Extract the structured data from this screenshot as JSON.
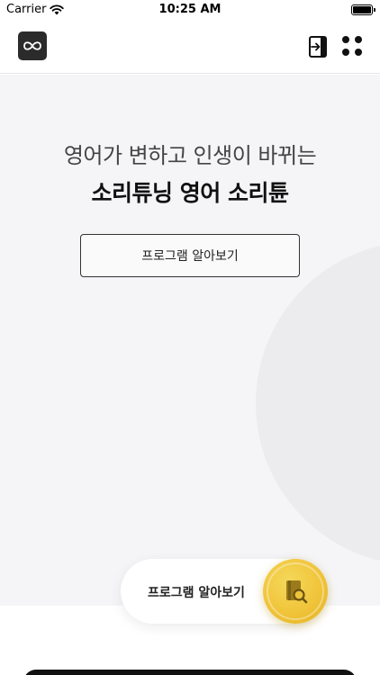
{
  "status_bar": {
    "carrier": "Carrier",
    "time": "10:25 AM",
    "wifi_icon": "wifi-icon",
    "battery_icon": "battery-icon"
  },
  "header": {
    "logo_icon": "infinity-logo-icon",
    "login_icon": "login-icon",
    "menu_icon": "four-dots-menu-icon"
  },
  "hero": {
    "tagline": "영어가 변하고 인생이 바뀌는",
    "headline": "소리튜닝 영어 소리튠",
    "button_label": "프로그램 알아보기"
  },
  "floating_cta": {
    "label": "프로그램 알아보기",
    "icon": "book-search-icon",
    "accent": "#f0c43a"
  },
  "colors": {
    "hero_bg": "#f5f5f7",
    "decoration": "#ececee",
    "logo_bg": "#2b2b2b",
    "bottom_bar": "#111111"
  }
}
